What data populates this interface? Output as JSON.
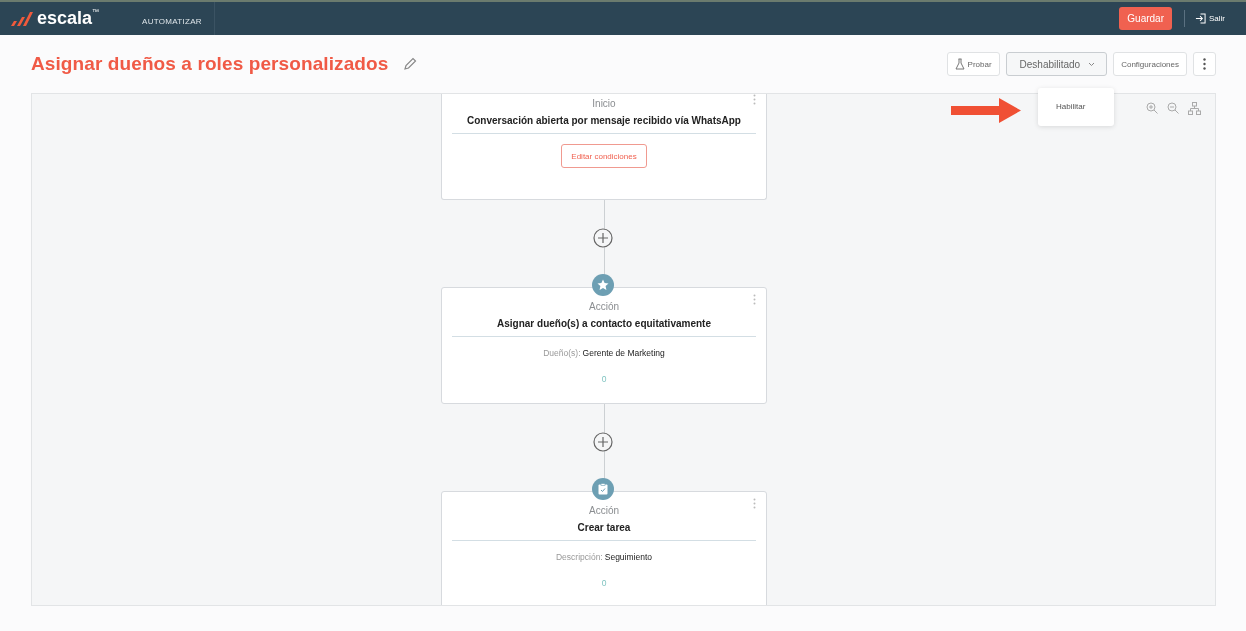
{
  "header": {
    "logo": "escala",
    "logo_mark": "™",
    "nav": "AUTOMATIZAR",
    "save_button": "Guardar",
    "logout": "Salir"
  },
  "page": {
    "title": "Asignar dueños a roles personalizados"
  },
  "toolbar": {
    "test_button": "Probar",
    "status_dropdown": {
      "value": "Deshabilitado",
      "expanded": true,
      "options": [
        "Habilitar"
      ]
    },
    "settings_button": "Configuraciones"
  },
  "nodes": [
    {
      "kind": "trigger",
      "label": "Inicio",
      "title": "Conversación abierta por mensaje recibido vía WhatsApp",
      "button": "Editar condiciones"
    },
    {
      "kind": "action",
      "label": "Acción",
      "title": "Asignar dueño(s) a contacto equitativamente",
      "detail_label": "Dueño(s):",
      "detail_value": "Gerente de Marketing",
      "count": "0"
    },
    {
      "kind": "action",
      "label": "Acción",
      "title": "Crear tarea",
      "detail_label": "Descripción:",
      "detail_value": "Seguimiento",
      "count": "0"
    }
  ]
}
